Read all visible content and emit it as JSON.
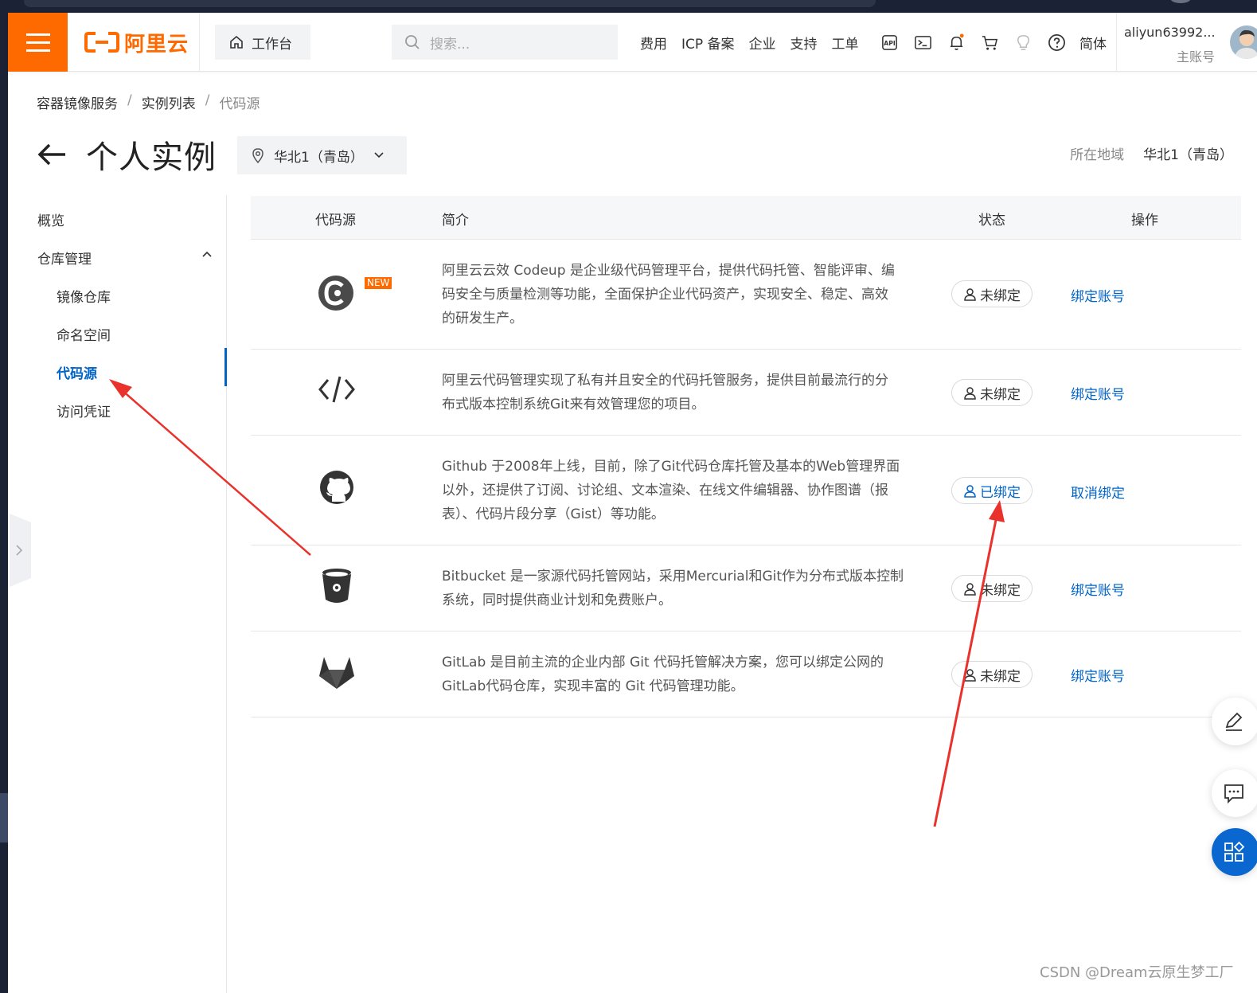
{
  "topbar": {
    "logo_text": "阿里云",
    "workbench": "工作台",
    "search_placeholder": "搜索...",
    "nav_links": [
      "费用",
      "ICP 备案",
      "企业",
      "支持",
      "工单"
    ],
    "lang": "简体",
    "user": "aliyun63992...",
    "role": "主账号",
    "icons": [
      "api-icon",
      "terminal-icon",
      "bell-icon",
      "cart-icon",
      "bulb-icon",
      "help-icon"
    ]
  },
  "breadcrumb": {
    "items": [
      "容器镜像服务",
      "实例列表"
    ],
    "current": "代码源"
  },
  "page": {
    "title": "个人实例",
    "region": "华北1（青岛）",
    "region_label": "所在地域",
    "region_value": "华北1（青岛）"
  },
  "sidebar": {
    "overview": "概览",
    "repo_mgmt": "仓库管理",
    "items": [
      "镜像仓库",
      "命名空间",
      "代码源",
      "访问凭证"
    ]
  },
  "table": {
    "headers": [
      "代码源",
      "简介",
      "状态",
      "操作"
    ],
    "rows": [
      {
        "icon": "codeup-icon",
        "badge": "NEW",
        "desc_lines": [
          "阿里云云效 Codeup 是企业级代码管理平台，提供代码托管、智能评审、编",
          "码安全与质量检测等功能，全面保护企业代码资产，实现安全、稳定、高效",
          "的研发生产。"
        ],
        "status": "未绑定",
        "action": "绑定账号"
      },
      {
        "icon": "code-icon",
        "desc_lines": [
          "阿里云代码管理实现了私有并且安全的代码托管服务，提供目前最流行的分",
          "布式版本控制系统Git来有效管理您的项目。"
        ],
        "status": "未绑定",
        "action": "绑定账号"
      },
      {
        "icon": "github-icon",
        "desc_lines": [
          "Github 于2008年上线，目前，除了Git代码仓库托管及基本的Web管理界面",
          "以外，还提供了订阅、讨论组、文本渲染、在线文件编辑器、协作图谱（报",
          "表）、代码片段分享（Gist）等功能。"
        ],
        "status": "已绑定",
        "action": "取消绑定"
      },
      {
        "icon": "bitbucket-icon",
        "desc_lines": [
          "Bitbucket 是一家源代码托管网站，采用Mercurial和Git作为分布式版本控制",
          "系统，同时提供商业计划和免费账户。"
        ],
        "status": "未绑定",
        "action": "绑定账号"
      },
      {
        "icon": "gitlab-icon",
        "desc_lines": [
          "GitLab 是目前主流的企业内部 Git 代码托管解决方案，您可以绑定公网的",
          "GitLab代码仓库，实现丰富的 Git 代码管理功能。"
        ],
        "status": "未绑定",
        "action": "绑定账号"
      }
    ]
  },
  "watermark": "CSDN @Dream云原生梦工厂",
  "colors": {
    "brand": "#ff6a00",
    "link": "#0064c8",
    "annotation": "#e8322b"
  }
}
